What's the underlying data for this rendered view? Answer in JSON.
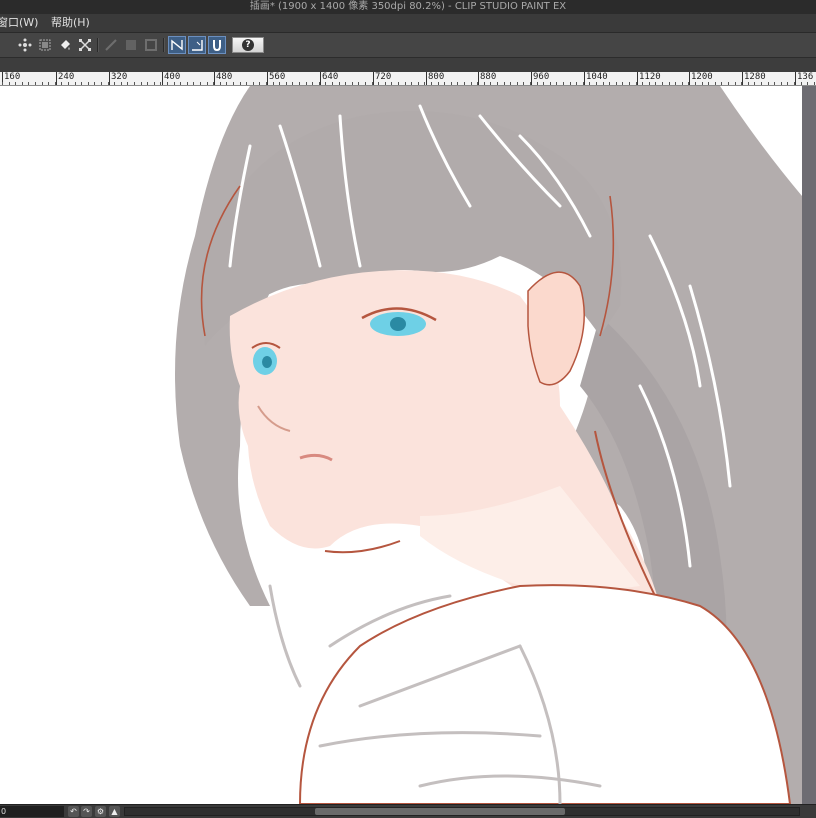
{
  "window": {
    "title": "插画* (1900 x 1400 像素 350dpi 80.2%)  - CLIP STUDIO PAINT EX"
  },
  "menu": {
    "items": [
      "窗口(W)",
      "帮助(H)"
    ]
  },
  "toolbar": {
    "buttons": [
      {
        "icon": "select-transform-icon"
      },
      {
        "icon": "select-invert-icon"
      },
      {
        "icon": "fill-bucket-icon"
      },
      {
        "icon": "transform-crop-icon"
      },
      {
        "icon": "ruler-disabled-icon"
      },
      {
        "icon": "layer-disabled-icon"
      },
      {
        "icon": "frame-disabled-icon"
      },
      {
        "icon": "curve-pen-icon"
      },
      {
        "icon": "corner-pen-icon"
      },
      {
        "icon": "magnet-snap-icon"
      }
    ],
    "help_symbol": "?"
  },
  "ruler": {
    "labels": [
      "160",
      "240",
      "320",
      "400",
      "480",
      "560",
      "640",
      "720",
      "800",
      "880",
      "960",
      "1040",
      "1120",
      "1200",
      "1280",
      "136"
    ]
  },
  "status": {
    "zoom": "0",
    "nav_buttons": [
      "↶",
      "↷",
      "⚙",
      "▲"
    ]
  },
  "colors": {
    "hair": "#b3adad",
    "skin": "#fbe3dc",
    "line": "#b5563f",
    "eye": "#6ed0e6",
    "canvas_bg": "#ffffff",
    "ui_dark": "#3c3c3c",
    "ui_accent": "#3e5f86"
  }
}
